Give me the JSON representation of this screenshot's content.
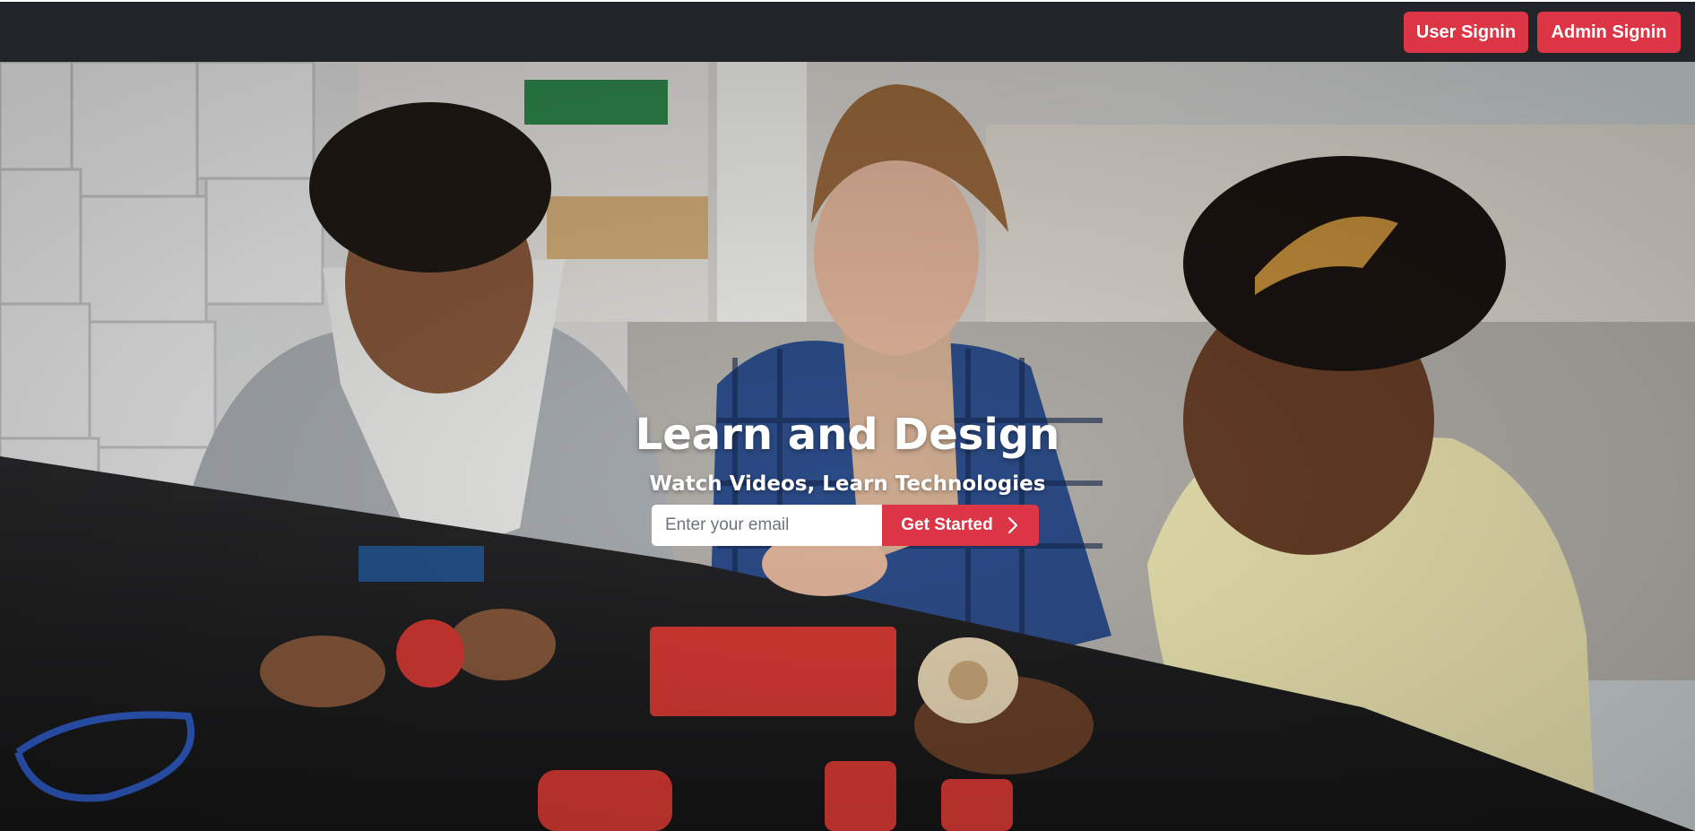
{
  "navbar": {
    "user_signin_label": "User Signin",
    "admin_signin_label": "Admin Signin"
  },
  "hero": {
    "title": "Learn and Design",
    "subtitle": "Watch Videos, Learn Technologies",
    "email_placeholder": "Enter your email",
    "email_value": "",
    "cta_label": "Get Started",
    "cta_icon": "chevron-right-icon",
    "background_image": "kids-building-robotics-photo"
  },
  "colors": {
    "navbar_bg": "#212529",
    "accent": "#dc3545",
    "text_light": "#ffffff"
  }
}
